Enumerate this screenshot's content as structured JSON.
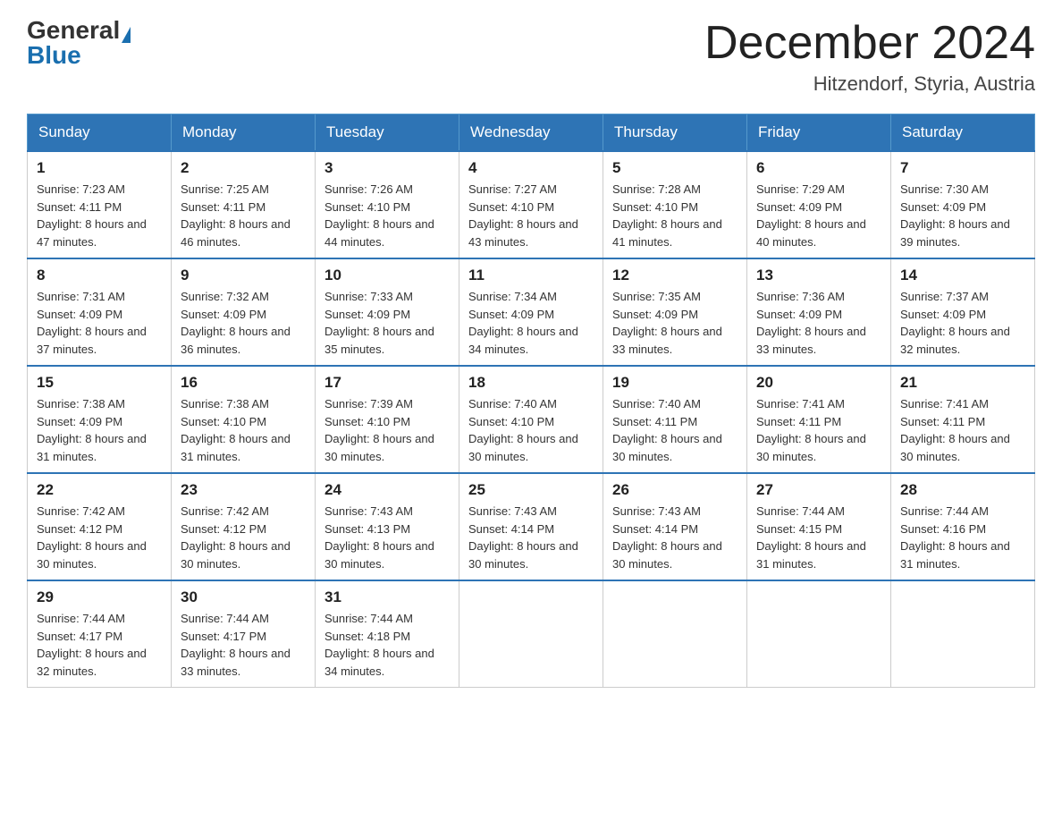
{
  "header": {
    "logo_general": "General",
    "logo_blue": "Blue",
    "month_title": "December 2024",
    "location": "Hitzendorf, Styria, Austria"
  },
  "days_of_week": [
    "Sunday",
    "Monday",
    "Tuesday",
    "Wednesday",
    "Thursday",
    "Friday",
    "Saturday"
  ],
  "weeks": [
    [
      {
        "day": "1",
        "sunrise": "7:23 AM",
        "sunset": "4:11 PM",
        "daylight": "8 hours and 47 minutes."
      },
      {
        "day": "2",
        "sunrise": "7:25 AM",
        "sunset": "4:11 PM",
        "daylight": "8 hours and 46 minutes."
      },
      {
        "day": "3",
        "sunrise": "7:26 AM",
        "sunset": "4:10 PM",
        "daylight": "8 hours and 44 minutes."
      },
      {
        "day": "4",
        "sunrise": "7:27 AM",
        "sunset": "4:10 PM",
        "daylight": "8 hours and 43 minutes."
      },
      {
        "day": "5",
        "sunrise": "7:28 AM",
        "sunset": "4:10 PM",
        "daylight": "8 hours and 41 minutes."
      },
      {
        "day": "6",
        "sunrise": "7:29 AM",
        "sunset": "4:09 PM",
        "daylight": "8 hours and 40 minutes."
      },
      {
        "day": "7",
        "sunrise": "7:30 AM",
        "sunset": "4:09 PM",
        "daylight": "8 hours and 39 minutes."
      }
    ],
    [
      {
        "day": "8",
        "sunrise": "7:31 AM",
        "sunset": "4:09 PM",
        "daylight": "8 hours and 37 minutes."
      },
      {
        "day": "9",
        "sunrise": "7:32 AM",
        "sunset": "4:09 PM",
        "daylight": "8 hours and 36 minutes."
      },
      {
        "day": "10",
        "sunrise": "7:33 AM",
        "sunset": "4:09 PM",
        "daylight": "8 hours and 35 minutes."
      },
      {
        "day": "11",
        "sunrise": "7:34 AM",
        "sunset": "4:09 PM",
        "daylight": "8 hours and 34 minutes."
      },
      {
        "day": "12",
        "sunrise": "7:35 AM",
        "sunset": "4:09 PM",
        "daylight": "8 hours and 33 minutes."
      },
      {
        "day": "13",
        "sunrise": "7:36 AM",
        "sunset": "4:09 PM",
        "daylight": "8 hours and 33 minutes."
      },
      {
        "day": "14",
        "sunrise": "7:37 AM",
        "sunset": "4:09 PM",
        "daylight": "8 hours and 32 minutes."
      }
    ],
    [
      {
        "day": "15",
        "sunrise": "7:38 AM",
        "sunset": "4:09 PM",
        "daylight": "8 hours and 31 minutes."
      },
      {
        "day": "16",
        "sunrise": "7:38 AM",
        "sunset": "4:10 PM",
        "daylight": "8 hours and 31 minutes."
      },
      {
        "day": "17",
        "sunrise": "7:39 AM",
        "sunset": "4:10 PM",
        "daylight": "8 hours and 30 minutes."
      },
      {
        "day": "18",
        "sunrise": "7:40 AM",
        "sunset": "4:10 PM",
        "daylight": "8 hours and 30 minutes."
      },
      {
        "day": "19",
        "sunrise": "7:40 AM",
        "sunset": "4:11 PM",
        "daylight": "8 hours and 30 minutes."
      },
      {
        "day": "20",
        "sunrise": "7:41 AM",
        "sunset": "4:11 PM",
        "daylight": "8 hours and 30 minutes."
      },
      {
        "day": "21",
        "sunrise": "7:41 AM",
        "sunset": "4:11 PM",
        "daylight": "8 hours and 30 minutes."
      }
    ],
    [
      {
        "day": "22",
        "sunrise": "7:42 AM",
        "sunset": "4:12 PM",
        "daylight": "8 hours and 30 minutes."
      },
      {
        "day": "23",
        "sunrise": "7:42 AM",
        "sunset": "4:12 PM",
        "daylight": "8 hours and 30 minutes."
      },
      {
        "day": "24",
        "sunrise": "7:43 AM",
        "sunset": "4:13 PM",
        "daylight": "8 hours and 30 minutes."
      },
      {
        "day": "25",
        "sunrise": "7:43 AM",
        "sunset": "4:14 PM",
        "daylight": "8 hours and 30 minutes."
      },
      {
        "day": "26",
        "sunrise": "7:43 AM",
        "sunset": "4:14 PM",
        "daylight": "8 hours and 30 minutes."
      },
      {
        "day": "27",
        "sunrise": "7:44 AM",
        "sunset": "4:15 PM",
        "daylight": "8 hours and 31 minutes."
      },
      {
        "day": "28",
        "sunrise": "7:44 AM",
        "sunset": "4:16 PM",
        "daylight": "8 hours and 31 minutes."
      }
    ],
    [
      {
        "day": "29",
        "sunrise": "7:44 AM",
        "sunset": "4:17 PM",
        "daylight": "8 hours and 32 minutes."
      },
      {
        "day": "30",
        "sunrise": "7:44 AM",
        "sunset": "4:17 PM",
        "daylight": "8 hours and 33 minutes."
      },
      {
        "day": "31",
        "sunrise": "7:44 AM",
        "sunset": "4:18 PM",
        "daylight": "8 hours and 34 minutes."
      },
      null,
      null,
      null,
      null
    ]
  ]
}
